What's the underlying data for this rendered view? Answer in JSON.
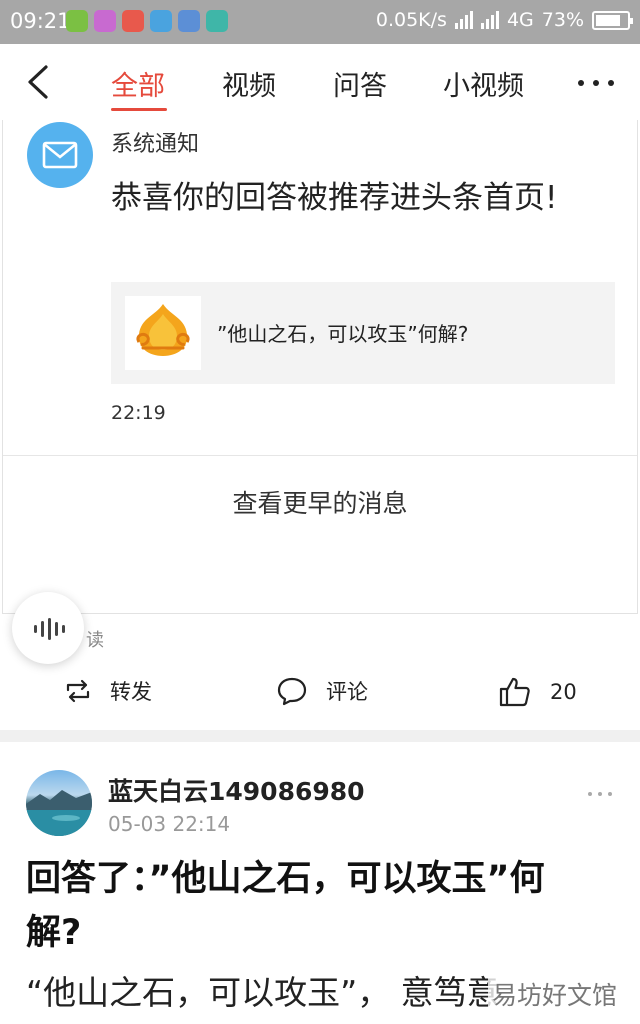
{
  "status_bar": {
    "time": "09:21",
    "network_speed": "0.05K/s",
    "network_type": "4G",
    "battery": "73%"
  },
  "nav": {
    "tabs": [
      {
        "label": "全部"
      },
      {
        "label": "视频"
      },
      {
        "label": "问答"
      },
      {
        "label": "小视频"
      }
    ]
  },
  "notification": {
    "sender": "系统通知",
    "message": "恭喜你的回答被推荐进头条首页!",
    "ref_question": "”他山之石，可以攻玉”何解?",
    "time": "22:19",
    "view_earlier": "查看更早的消息"
  },
  "voice": {
    "label": "读"
  },
  "actions": {
    "repost": "转发",
    "comment": "评论",
    "like_count": "20"
  },
  "post": {
    "author": "蓝天白云149086980",
    "time": "05-03 22:14",
    "title": "回答了：”他山之石，可以攻玉”何解?",
    "body": "“他山之石，可以攻玉”， 意笃意"
  },
  "watermark": "易坊好文馆"
}
